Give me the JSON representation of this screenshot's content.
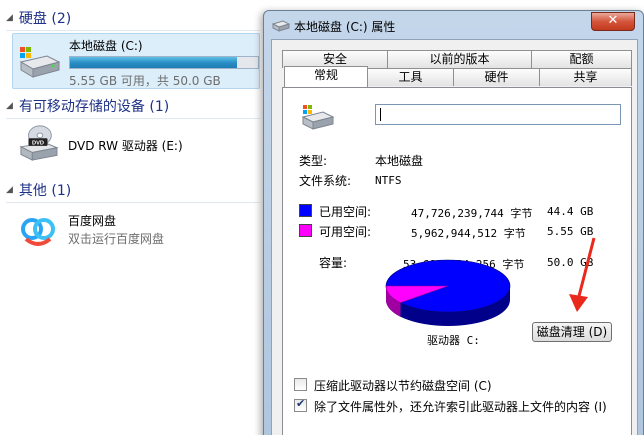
{
  "explorer": {
    "groups": [
      {
        "label": "硬盘 (2)"
      },
      {
        "label": "有可移动存储的设备 (1)"
      },
      {
        "label": "其他 (1)"
      }
    ],
    "drives": {
      "c": {
        "name": "本地磁盘 (C:)",
        "detail": "5.55 GB 可用，共 50.0 GB",
        "used_fraction": 0.889
      },
      "dvd": {
        "name": "DVD RW 驱动器 (E:)"
      },
      "baidu": {
        "name": "百度网盘",
        "detail": "双击运行百度网盘"
      }
    }
  },
  "dialog": {
    "title": "本地磁盘 (C:) 属性",
    "close_label": "✕",
    "tabs_back": [
      "安全",
      "以前的版本",
      "配额"
    ],
    "tabs_front": [
      "常规",
      "工具",
      "硬件",
      "共享"
    ],
    "active_tab": "常规",
    "name_value": "",
    "type_label": "类型:",
    "type_value": "本地磁盘",
    "fs_label": "文件系统:",
    "fs_value": "NTFS",
    "used": {
      "label": "已用空间:",
      "bytes": "47,726,239,744 字节",
      "size": "44.4 GB",
      "color": "#0000ff"
    },
    "free": {
      "label": "可用空间:",
      "bytes": "5,962,944,512 字节",
      "size": "5.55 GB",
      "color": "#ff00ff"
    },
    "capacity": {
      "label": "容量:",
      "bytes": "53,689,184,256 字节",
      "size": "50.0 GB"
    },
    "drive_label": "驱动器 C:",
    "cleanup_button": "磁盘清理 (D)",
    "compress_checkbox": {
      "label": "压缩此驱动器以节约磁盘空间 (C)",
      "checked": false
    },
    "index_checkbox": {
      "label": "除了文件属性外，还允许索引此驱动器上文件的内容 (I)",
      "checked": true
    }
  },
  "colors": {
    "accent_arrow": "#e8291c",
    "selection": "#ddeefb"
  }
}
